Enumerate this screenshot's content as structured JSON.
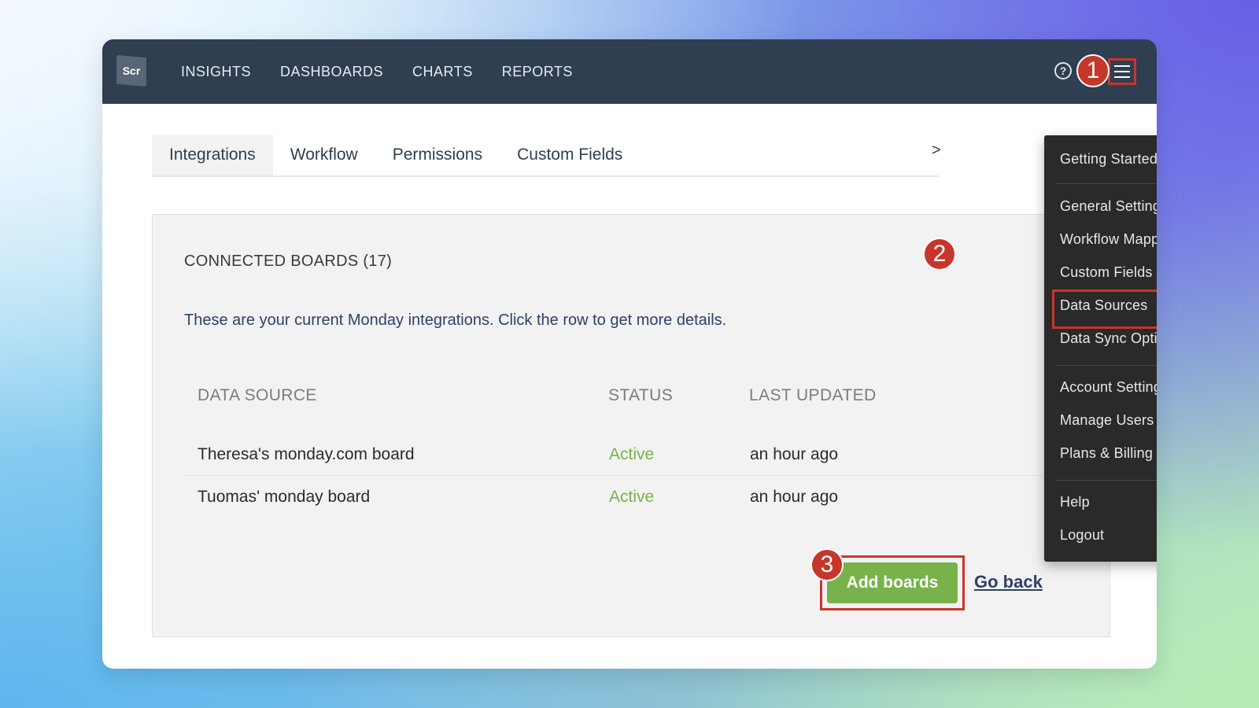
{
  "nav": {
    "logo_text": "Scr",
    "links": [
      "INSIGHTS",
      "DASHBOARDS",
      "CHARTS",
      "REPORTS"
    ],
    "help_icon": "question-circle-icon",
    "menu_icon": "hamburger-icon"
  },
  "tabs": {
    "items": [
      "Integrations",
      "Workflow",
      "Permissions",
      "Custom Fields"
    ],
    "active": "Integrations",
    "more": ">"
  },
  "panel": {
    "title": "CONNECTED BOARDS (17)",
    "description": "These are your current Monday integrations. Click the row to get more details.",
    "columns": [
      "DATA SOURCE",
      "STATUS",
      "LAST UPDATED"
    ],
    "rows": [
      {
        "name": "Theresa's monday.com board",
        "status": "Active",
        "updated": "an hour ago"
      },
      {
        "name": "Tuomas' monday board",
        "status": "Active",
        "updated": "an hour ago"
      }
    ],
    "add_button": "Add boards",
    "go_back": "Go back"
  },
  "menu": {
    "group1": [
      "Getting Started"
    ],
    "group2": [
      "General Settings",
      "Workflow Mapping",
      "Custom Fields",
      "Data Sources",
      "Data Sync Options"
    ],
    "group3": [
      "Account Settings",
      "Manage Users",
      "Plans & Billing"
    ],
    "group4": [
      "Help",
      "Logout"
    ]
  },
  "callouts": [
    "1",
    "2",
    "3"
  ],
  "colors": {
    "navbar": "#2f3e50",
    "highlight": "#c7362b",
    "active_status": "#76b34b",
    "primary_button": "#77b24b",
    "menu_bg": "#2a2a2a"
  }
}
